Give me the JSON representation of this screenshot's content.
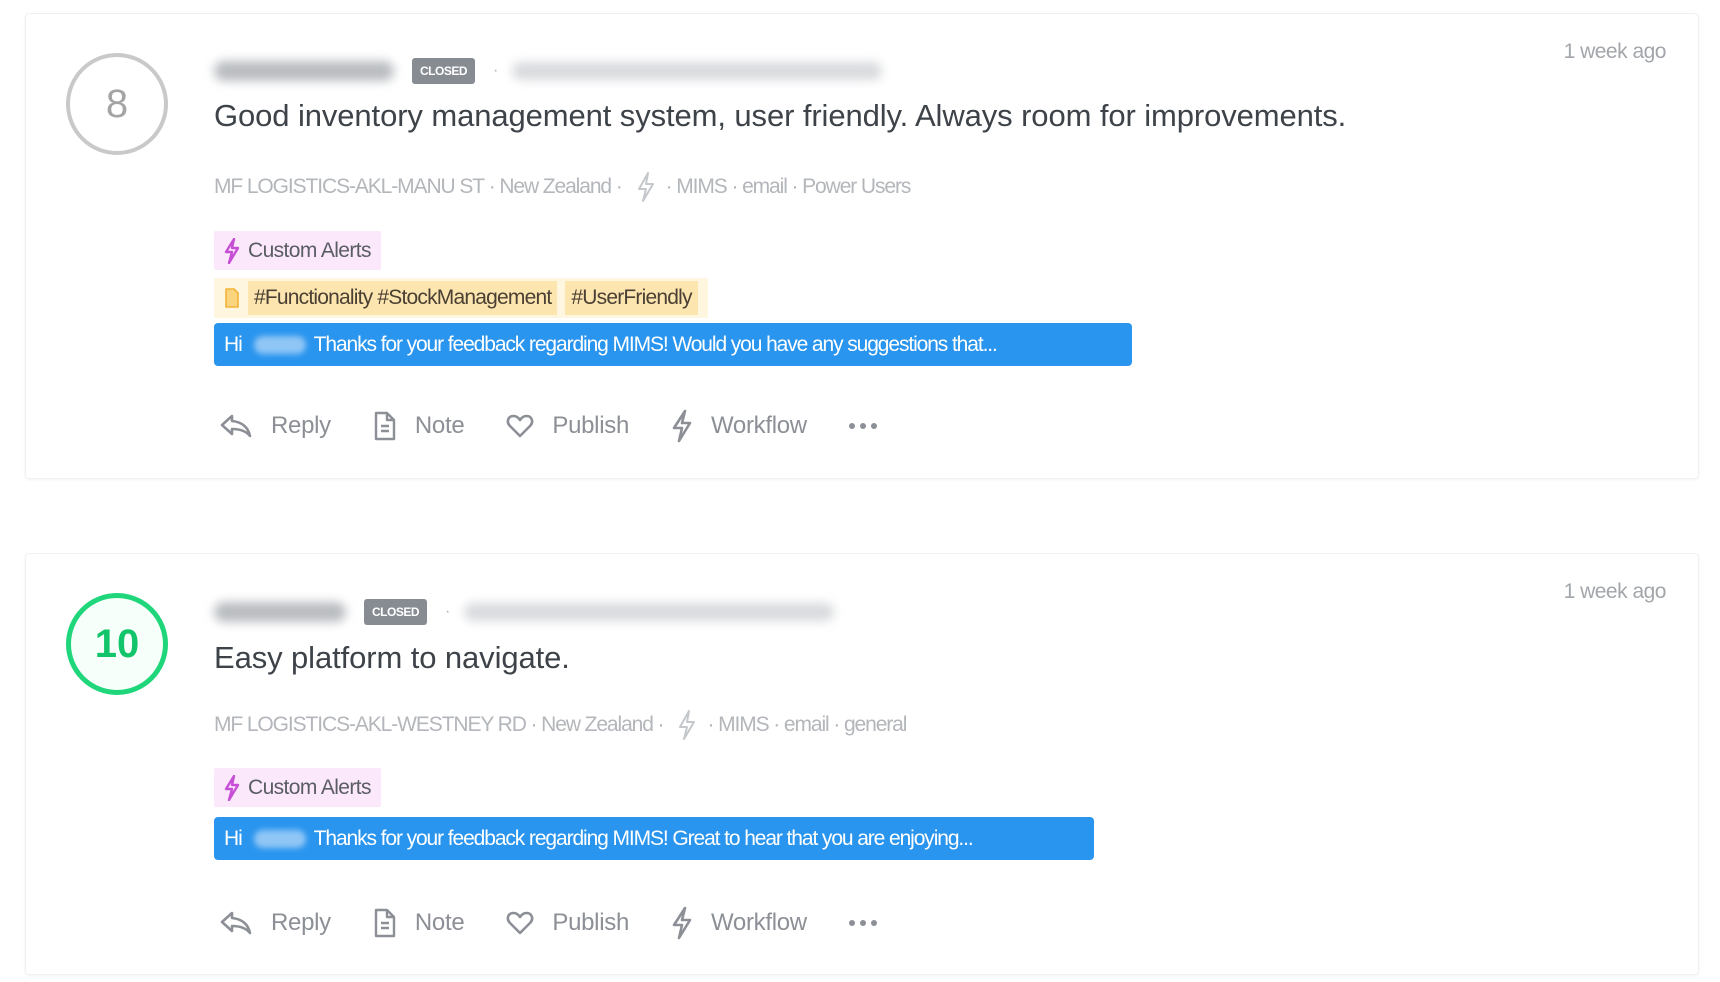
{
  "responses": [
    {
      "score": "8",
      "score_category": "passive",
      "respondent_name": "[redacted name]",
      "status_badge": "CLOSED",
      "respondent_email": "[redacted email]",
      "timestamp": "1 week ago",
      "comment": "Good inventory management system, user friendly. Always room for improvements.",
      "meta": {
        "location": "MF LOGISTICS-AKL-MANU ST",
        "country": "New Zealand",
        "product": "MIMS",
        "channel": "email",
        "segment": "Power Users"
      },
      "alert_tag": "Custom Alerts",
      "hashtags": [
        "#Functionality #StockManagement",
        "#UserFriendly"
      ],
      "reply_preview": {
        "greeting": "Hi",
        "text": "Thanks for your feedback regarding MIMS! Would you have any suggestions that..."
      }
    },
    {
      "score": "10",
      "score_category": "promoter",
      "respondent_name": "[redacted name]",
      "status_badge": "CLOSED",
      "respondent_email": "[redacted email]",
      "timestamp": "1 week ago",
      "comment": "Easy platform to navigate.",
      "meta": {
        "location": "MF LOGISTICS-AKL-WESTNEY RD",
        "country": "New Zealand",
        "product": "MIMS",
        "channel": "email",
        "segment": "general"
      },
      "alert_tag": "Custom Alerts",
      "hashtags": [],
      "reply_preview": {
        "greeting": "Hi",
        "text": "Thanks for your feedback regarding MIMS! Great to hear that you are enjoying..."
      }
    }
  ],
  "actions": {
    "reply": "Reply",
    "note": "Note",
    "publish": "Publish",
    "workflow": "Workflow",
    "more_icon": "more-horizontal-icon"
  },
  "separators": {
    "dot": "·"
  },
  "colors": {
    "promoter": "#20d67b",
    "passive": "#c9c9c9",
    "reply_bar": "#2a95ee",
    "alert_tag_bg": "#fce8fb",
    "alert_icon": "#c64fd6",
    "hashtag_bg": "#fde5b0",
    "closed_badge": "#868c92"
  }
}
